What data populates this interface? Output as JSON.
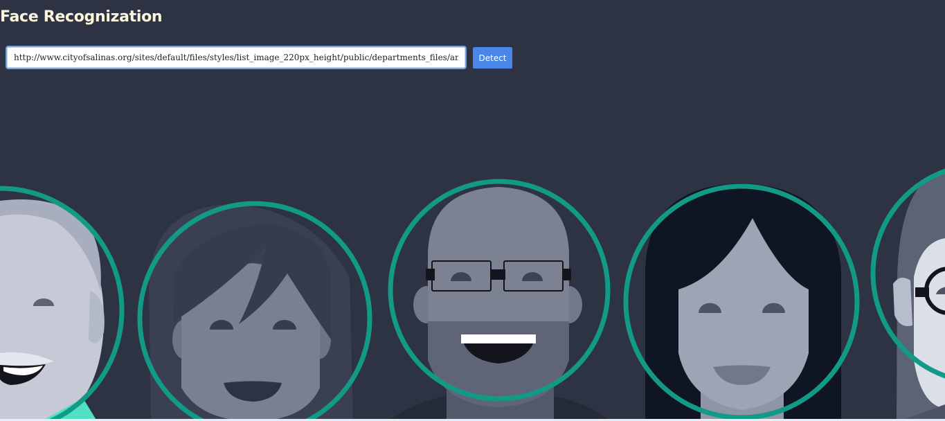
{
  "page": {
    "title": "Face Recognization"
  },
  "form": {
    "url_value": "http://www.cityofsalinas.org/sites/default/files/styles/list_image_220px_height/public/departments_files/animal_se",
    "detect_label": "Detect"
  },
  "colors": {
    "background": "#2d3343",
    "title": "#fdf6dc",
    "accent_button": "#4a86e8",
    "detection_ring": "#129a87"
  },
  "illustration": {
    "faces_count": 5
  }
}
